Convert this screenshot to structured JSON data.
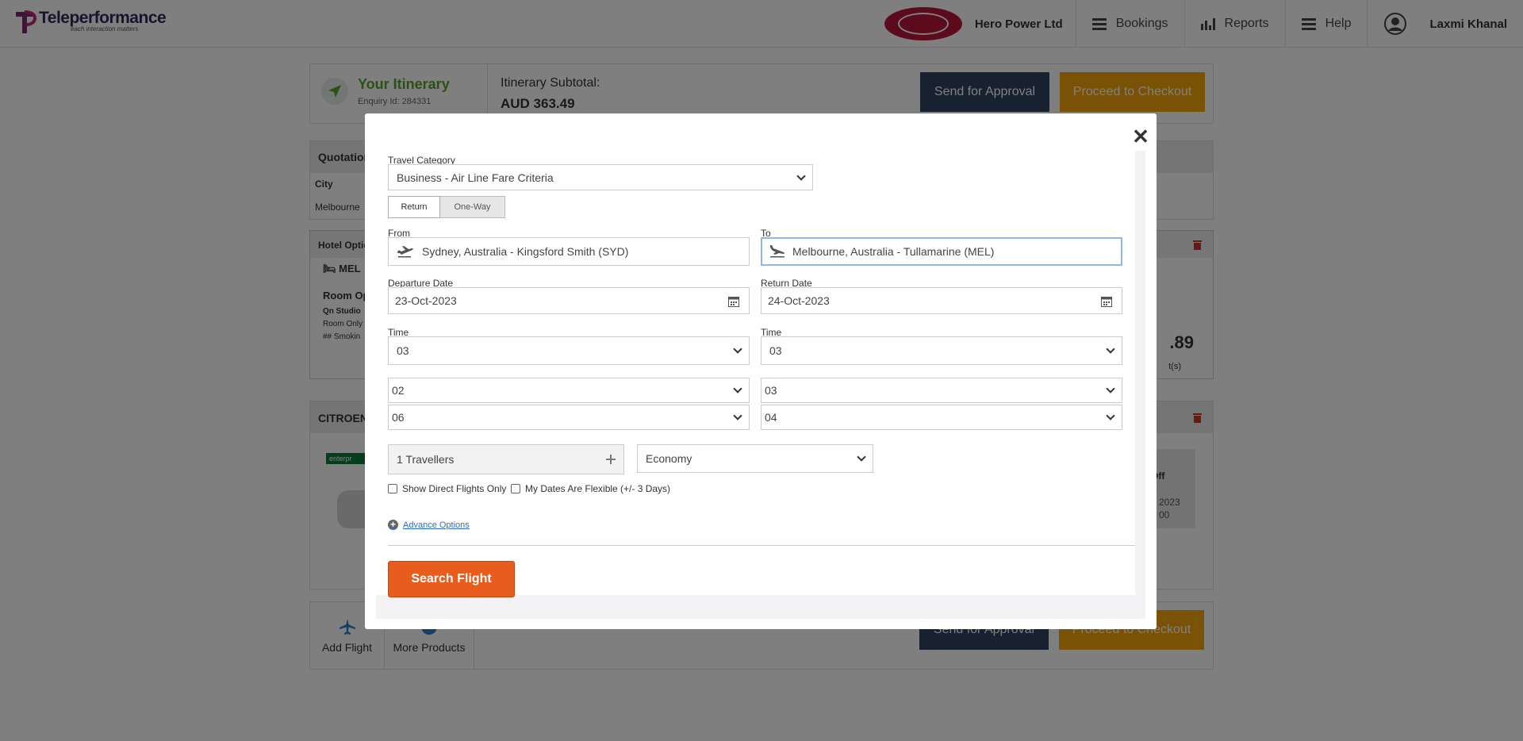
{
  "header": {
    "logo_name": "Teleperformance",
    "logo_tagline": "each interaction matters",
    "company": "Hero Power Ltd",
    "nav": {
      "bookings": "Bookings",
      "reports": "Reports",
      "help": "Help"
    },
    "user": "Laxmi Khanal"
  },
  "itinerary": {
    "title": "Your Itinerary",
    "enquiry": "Enquiry Id: 284331",
    "subtotal_label": "Itinerary Subtotal:",
    "subtotal_value": "AUD  363.49",
    "approval_label": "Send for Approval",
    "checkout_label": "Proceed to Checkout"
  },
  "quotation": {
    "head": "Quotation",
    "city_label": "City",
    "city": "Melbourne"
  },
  "hotel": {
    "head": "Hotel Optio",
    "code": "MEL",
    "room": "Room Op",
    "line1": "Qn Studio",
    "line2": "Room Only",
    "line3": "## Smokin",
    "price": ".89",
    "night": "t(s)"
  },
  "car": {
    "head": "CITROEN",
    "brand": "enterpr",
    "offer": "-Off",
    "offer_date": "2023",
    "offer_time": "00"
  },
  "bottom": {
    "add_flight": "Add Flight",
    "more_products": "More Products"
  },
  "modal": {
    "travel_category_label": "Travel Category",
    "travel_category_value": "Business - Air Line Fare Criteria",
    "tabs": {
      "return": "Return",
      "oneway": "One-Way"
    },
    "from_label": "From",
    "from_value": "Sydney, Australia - Kingsford Smith (SYD)",
    "to_label": "To",
    "to_value": "Melbourne, Australia - Tullamarine (MEL)",
    "departure_label": "Departure Date",
    "departure_value": "23-Oct-2023",
    "return_label": "Return Date",
    "return_value": "24-Oct-2023",
    "time_label": "Time",
    "dep_time": "03",
    "ret_time": "03",
    "dep_sel2": "02",
    "ret_sel2": "03",
    "dep_sel3": "06",
    "ret_sel3": "04",
    "travellers": "1 Travellers",
    "cabin": "Economy",
    "direct_only": "Show Direct Flights Only",
    "flexible": "My Dates Are Flexible (+/- 3 Days)",
    "advance": "Advance Options",
    "search": "Search Flight"
  },
  "colors": {
    "accent_orange": "#e85d1e",
    "approval_navy": "#2f4260",
    "checkout_amber": "#f5a50b",
    "itinerary_green": "#5aa02c"
  }
}
